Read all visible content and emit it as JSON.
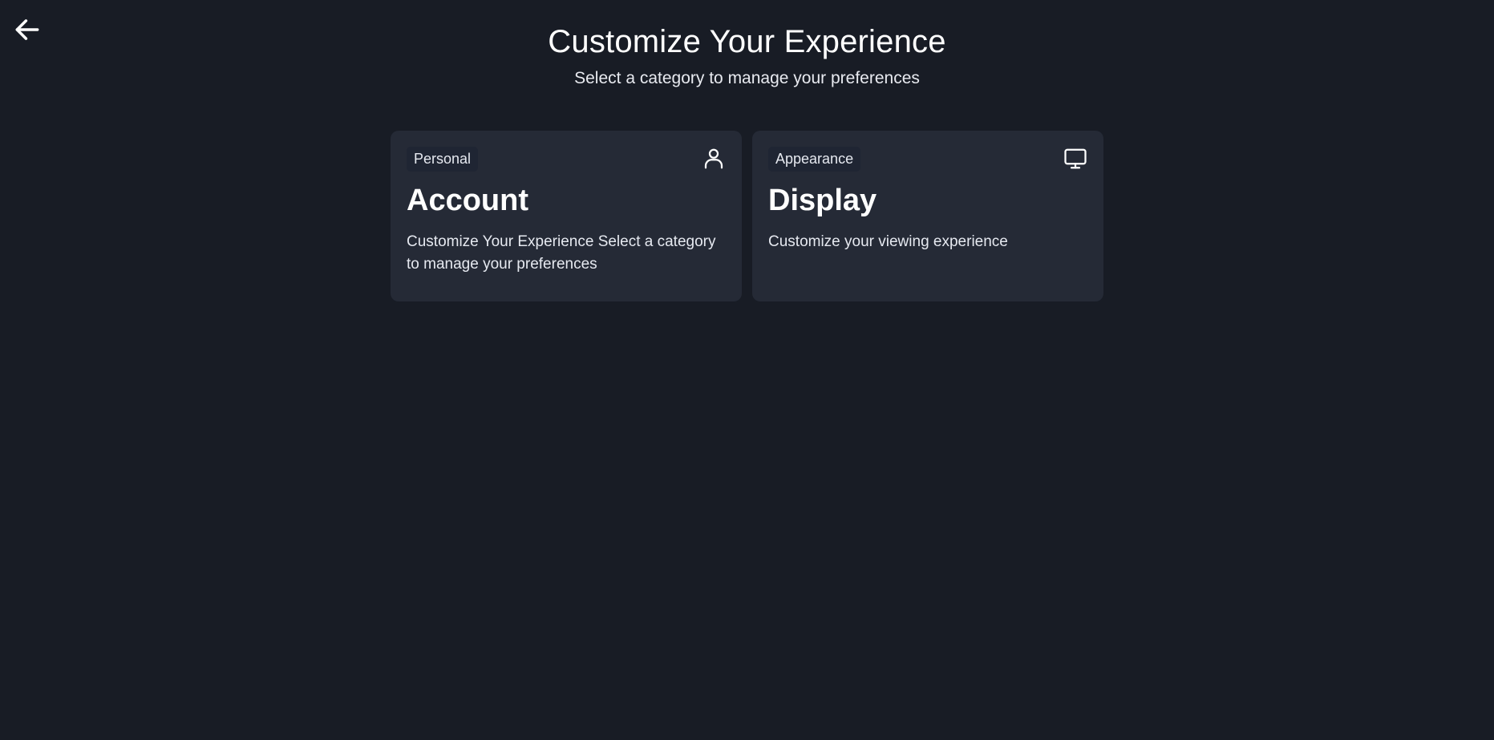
{
  "header": {
    "back_icon": "arrow-left-icon",
    "title": "Customize Your Experience",
    "subtitle": "Select a category to manage your preferences"
  },
  "cards": [
    {
      "badge": "Personal",
      "icon": "user-icon",
      "title": "Account",
      "description": "Customize Your Experience Select a category to manage your preferences"
    },
    {
      "badge": "Appearance",
      "icon": "monitor-icon",
      "title": "Display",
      "description": "Customize your viewing experience"
    }
  ],
  "colors": {
    "background": "#181c25",
    "card": "#252a36",
    "badge": "#1f2533",
    "text": "#ffffff"
  }
}
